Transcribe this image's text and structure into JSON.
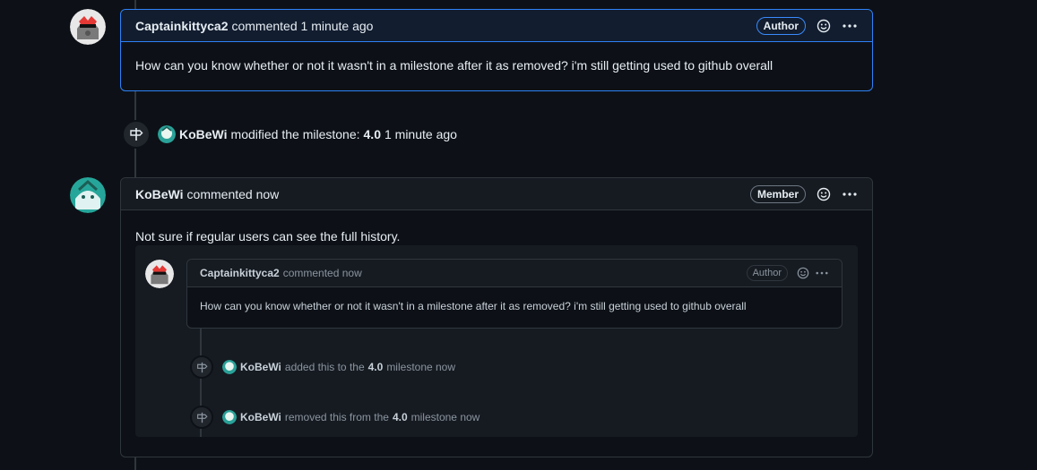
{
  "comment1": {
    "username": "Captainkittyca2",
    "action": "commented 1 minute ago",
    "badge": "Author",
    "body": "How can you know whether or not it wasn't in a milestone after it as removed? i'm still getting used to github overall"
  },
  "event1": {
    "user": "KoBeWi",
    "text": "modified the milestone:",
    "milestone": "4.0",
    "time": "1 minute ago"
  },
  "comment2": {
    "username": "KoBeWi",
    "action": "commented now",
    "badge": "Member",
    "body": "Not sure if regular users can see the full history."
  },
  "quoted": {
    "comment": {
      "username": "Captainkittyca2",
      "action": "commented now",
      "badge": "Author",
      "body": "How can you know whether or not it wasn't in a milestone after it as removed? i'm still getting used to github overall"
    },
    "event_added": {
      "user": "KoBeWi",
      "text": "added this to the",
      "milestone": "4.0",
      "suffix": "milestone now"
    },
    "event_removed": {
      "user": "KoBeWi",
      "text": "removed this from the",
      "milestone": "4.0",
      "suffix": "milestone now"
    }
  },
  "icons": {
    "emoji": "smiley-icon",
    "menu": "kebab-horizontal-icon",
    "milestone": "milestone-icon"
  },
  "colors": {
    "background": "#0d1117",
    "header": "#161b22",
    "border": "#30363d",
    "accent": "#2f81f7"
  }
}
